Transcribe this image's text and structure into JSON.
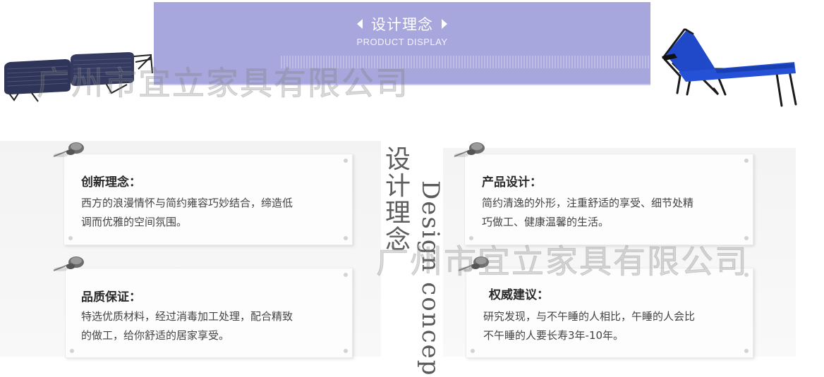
{
  "banner": {
    "title": "设计理念",
    "subtitle": "PRODUCT DISPLAY"
  },
  "watermark": {
    "text": "广州市宜立家具有限公司"
  },
  "center": {
    "title_cn": "设计理念",
    "title_en": "Design concep"
  },
  "cards": [
    {
      "title": "创新理念：",
      "lines": [
        "西方的浪漫情怀与简约雍容巧妙结合，缔造低",
        "调而优雅的空间氛围。"
      ]
    },
    {
      "title": "品质保证：",
      "lines": [
        "特选优质材料，经过消毒加工处理，配合精致",
        "的做工，给你舒适的居家享受。"
      ]
    },
    {
      "title": "产品设计：",
      "lines": [
        "简约清逸的外形，注重舒适的享受、细节处精",
        "巧做工、健康温馨的生活。"
      ]
    },
    {
      "title": "权威建议：",
      "lines": [
        "研究发现，与不午睡的人相比，午睡的人会比",
        "不午睡的人要长寿3年-10年。"
      ]
    }
  ],
  "colors": {
    "banner_bg": "#a7a6dd",
    "lounger_blue": "#1f49c9",
    "bed_navy": "#2f3558"
  },
  "icons": [
    "pushpin-icon",
    "triangle-left-icon",
    "triangle-right-icon"
  ]
}
